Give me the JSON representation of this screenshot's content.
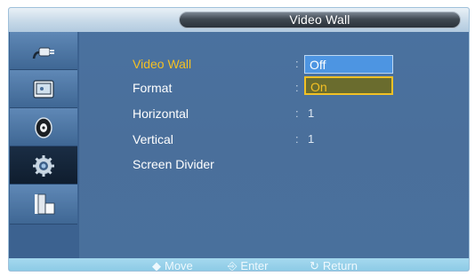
{
  "title": "Video Wall",
  "sidebar": {
    "items": [
      {
        "icon": "input-plug-icon",
        "active": false
      },
      {
        "icon": "picture-icon",
        "active": false
      },
      {
        "icon": "sound-icon",
        "active": false
      },
      {
        "icon": "setup-gear-icon",
        "active": true
      },
      {
        "icon": "multi-control-icon",
        "active": false
      }
    ]
  },
  "menu": {
    "items": [
      {
        "label": "Video Wall",
        "selected": true
      },
      {
        "label": "Format",
        "selected": false
      },
      {
        "label": "Horizontal",
        "value": "1",
        "selected": false
      },
      {
        "label": "Vertical",
        "value": "1",
        "selected": false
      },
      {
        "label": "Screen Divider",
        "selected": false
      }
    ],
    "colon": ":"
  },
  "dropdown": {
    "options": [
      "Off",
      "On"
    ],
    "highlighted": "On"
  },
  "footer": {
    "move": "Move",
    "enter": "Enter",
    "return": "Return"
  }
}
